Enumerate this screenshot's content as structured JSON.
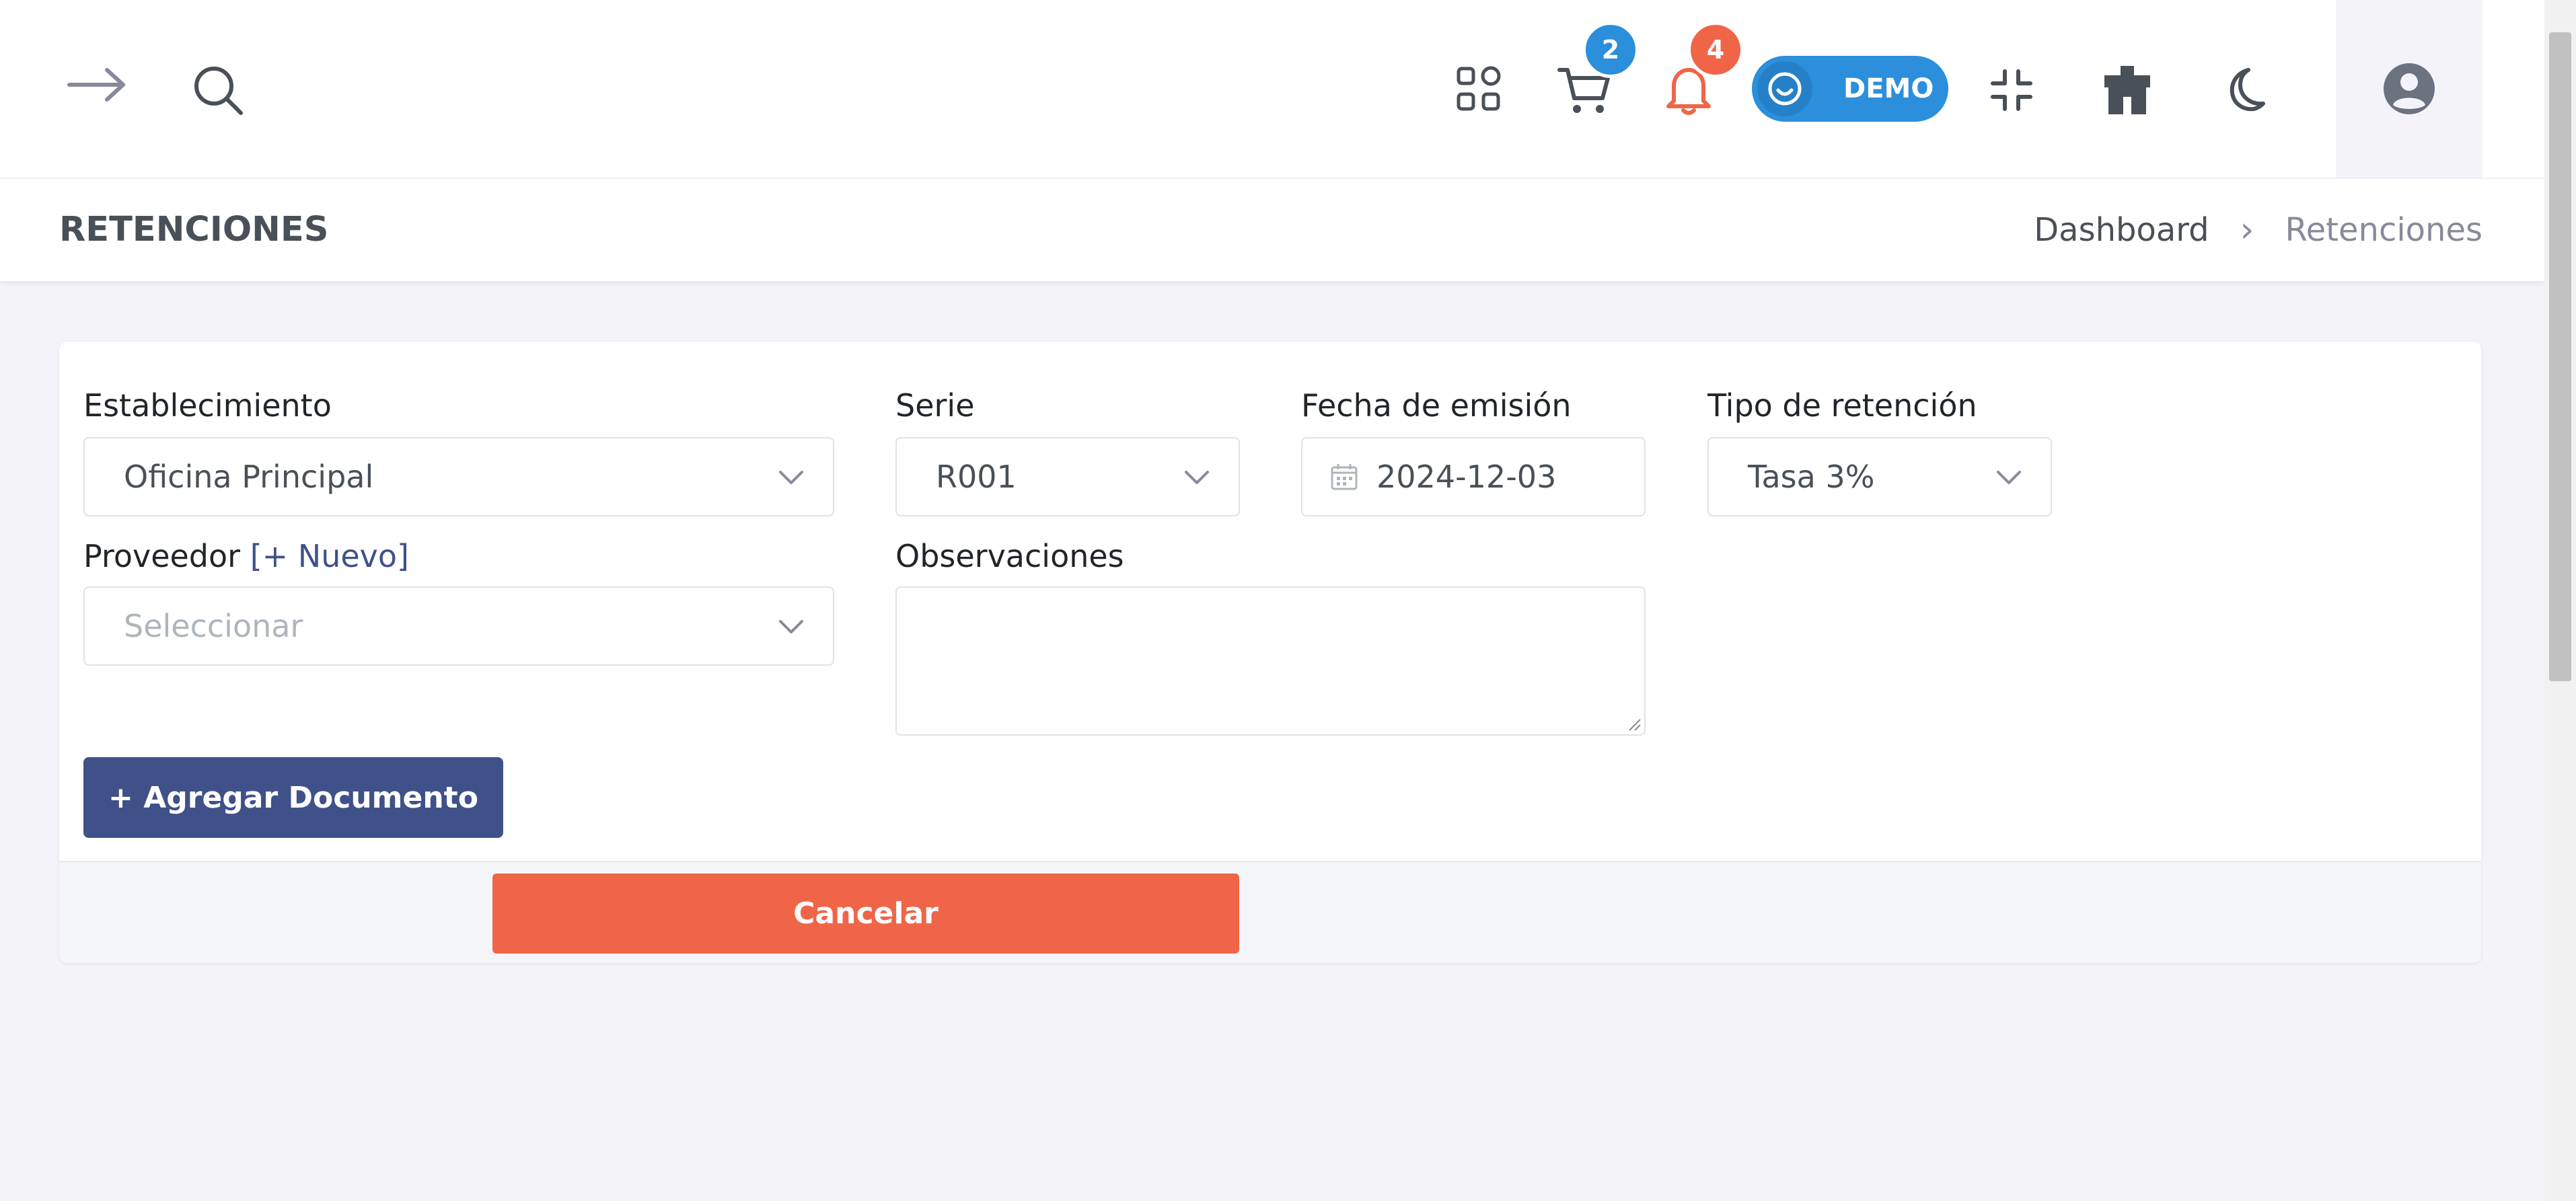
{
  "header": {
    "badges": {
      "cart_count": "2",
      "notifications_count": "4"
    },
    "demo_label": "DEMO",
    "colors": {
      "cart_badge": "#2b8fdc",
      "notification_badge": "#f06548",
      "demo": "#2b8fdc"
    }
  },
  "page": {
    "title": "RETENCIONES",
    "breadcrumb": {
      "home": "Dashboard",
      "separator": "›",
      "current": "Retenciones"
    }
  },
  "form": {
    "establecimiento": {
      "label": "Establecimiento",
      "value": "Oficina Principal"
    },
    "serie": {
      "label": "Serie",
      "value": "R001"
    },
    "fecha_emision": {
      "label": "Fecha de emisión",
      "value": "2024-12-03"
    },
    "tipo_retencion": {
      "label": "Tipo de retención",
      "value": "Tasa 3%"
    },
    "proveedor": {
      "label": "Proveedor",
      "new_link": "[+ Nuevo]",
      "placeholder": "Seleccionar"
    },
    "observaciones": {
      "label": "Observaciones",
      "value": ""
    },
    "add_document_label": "+ Agregar Documento",
    "cancel_label": "Cancelar"
  }
}
